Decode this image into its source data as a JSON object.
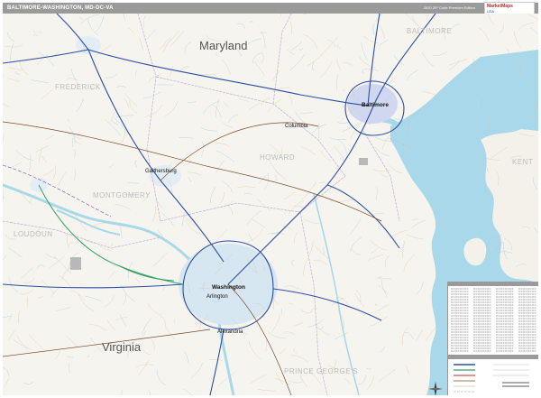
{
  "header": {
    "title": "BALTIMORE-WASHINGTON, MD-DC-VA",
    "edition": "2020 ZIP Code Premium Edition"
  },
  "logo": {
    "brand": "MarketMaps",
    "tagline": "USA"
  },
  "map": {
    "states": [
      "Maryland",
      "Virginia"
    ],
    "counties": [
      "BALTIMORE",
      "FREDERICK",
      "HOWARD",
      "MONTGOMERY",
      "LOUDOUN",
      "KENT",
      "PRINCE GEORGE'S"
    ],
    "cities": [
      "Baltimore",
      "Washington",
      "Arlington",
      "Alexandria",
      "Columbia",
      "Gaithersburg"
    ]
  },
  "colors": {
    "water": "#a8d8ea",
    "land": "#f6f4ee",
    "interstate": "#2b4ea6",
    "highway_green": "#38a169",
    "urban": "#cfe3f0",
    "header": "#9a9a9a"
  }
}
